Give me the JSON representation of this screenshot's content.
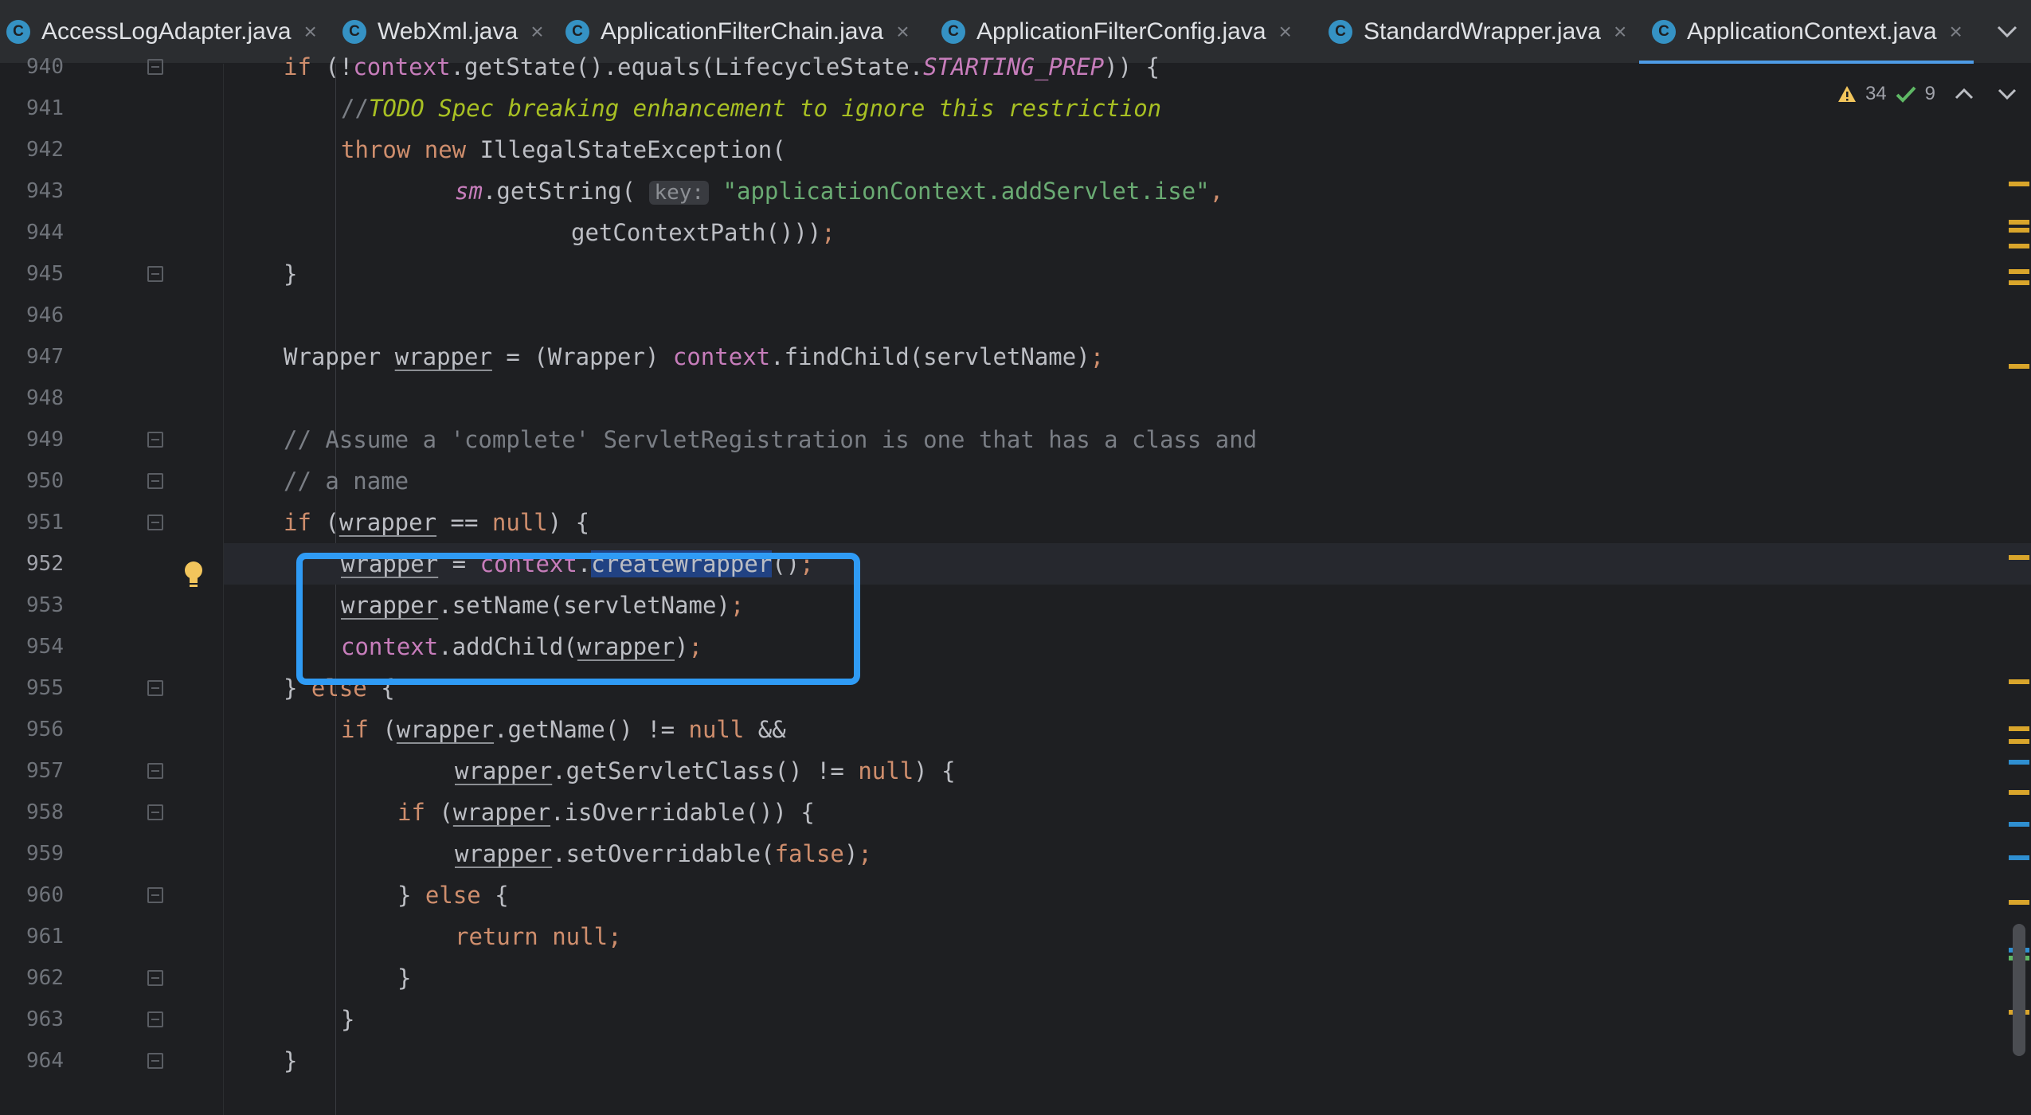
{
  "tabs": [
    {
      "label": "AccessLogAdapter.java",
      "active": false
    },
    {
      "label": "WebXml.java",
      "active": false
    },
    {
      "label": "ApplicationFilterChain.java",
      "active": false
    },
    {
      "label": "ApplicationFilterConfig.java",
      "active": false
    },
    {
      "label": "StandardWrapper.java",
      "active": false
    },
    {
      "label": "ApplicationContext.java",
      "active": true
    }
  ],
  "tab_icon_letter": "C",
  "tab_close_glyph": "×",
  "tab_menu_icon": "chevron-down-icon",
  "inspections": {
    "warnings": "34",
    "checks": "9"
  },
  "line_numbers": [
    "940",
    "941",
    "942",
    "943",
    "944",
    "945",
    "946",
    "947",
    "948",
    "949",
    "950",
    "951",
    "952",
    "953",
    "954",
    "955",
    "956",
    "957",
    "958",
    "959",
    "960",
    "961",
    "962",
    "963",
    "964"
  ],
  "current_line": "952",
  "code": {
    "l940": [
      "if",
      " (!",
      "context",
      ".getState().equals(LifecycleState.",
      "STARTING_PREP",
      ")) {"
    ],
    "l941": [
      "//",
      "TODO Spec breaking enhancement to ignore this restriction"
    ],
    "l942": [
      "throw new",
      " IllegalStateException("
    ],
    "l943": [
      "sm",
      ".getString( ",
      "key:",
      " ",
      "\"applicationContext.addServlet.ise\"",
      ","
    ],
    "l944": [
      "getContextPath()))",
      ";"
    ],
    "l945": [
      "}"
    ],
    "l947": [
      "Wrapper ",
      "wrapper",
      " = (Wrapper) ",
      "context",
      ".findChild(servletName)",
      ";"
    ],
    "l949": [
      "// Assume a 'complete' ServletRegistration is one that has a class and"
    ],
    "l950": [
      "// a name"
    ],
    "l951": [
      "if",
      " (",
      "wrapper",
      " == ",
      "null",
      ") {"
    ],
    "l952": [
      "wrapper",
      " = ",
      "context",
      ".",
      "createWrapper",
      "()",
      ";"
    ],
    "l953": [
      "wrapper",
      ".setName(servletName)",
      ";"
    ],
    "l954": [
      "context",
      ".addChild(",
      "wrapper",
      ")",
      ";"
    ],
    "l955": [
      "} ",
      "else",
      " {"
    ],
    "l956": [
      "if",
      " (",
      "wrapper",
      ".getName() != ",
      "null",
      " &&"
    ],
    "l957": [
      "wrapper",
      ".getServletClass() != ",
      "null",
      ") {"
    ],
    "l958": [
      "if",
      " (",
      "wrapper",
      ".isOverridable()) {"
    ],
    "l959": [
      "wrapper",
      ".setOverridable(",
      "false",
      ")",
      ";"
    ],
    "l960": [
      "} ",
      "else",
      " {"
    ],
    "l961": [
      "return null",
      ";"
    ],
    "l962": [
      "}"
    ],
    "l963": [
      "}"
    ],
    "l964": [
      "}"
    ]
  },
  "colors": {
    "keyword": "#cf8e6d",
    "field": "#c77dbb",
    "string": "#6aab73",
    "comment": "#7a7e85",
    "todo": "#a8c023",
    "highlight_box": "#2f9bf5",
    "selection": "#214283"
  }
}
